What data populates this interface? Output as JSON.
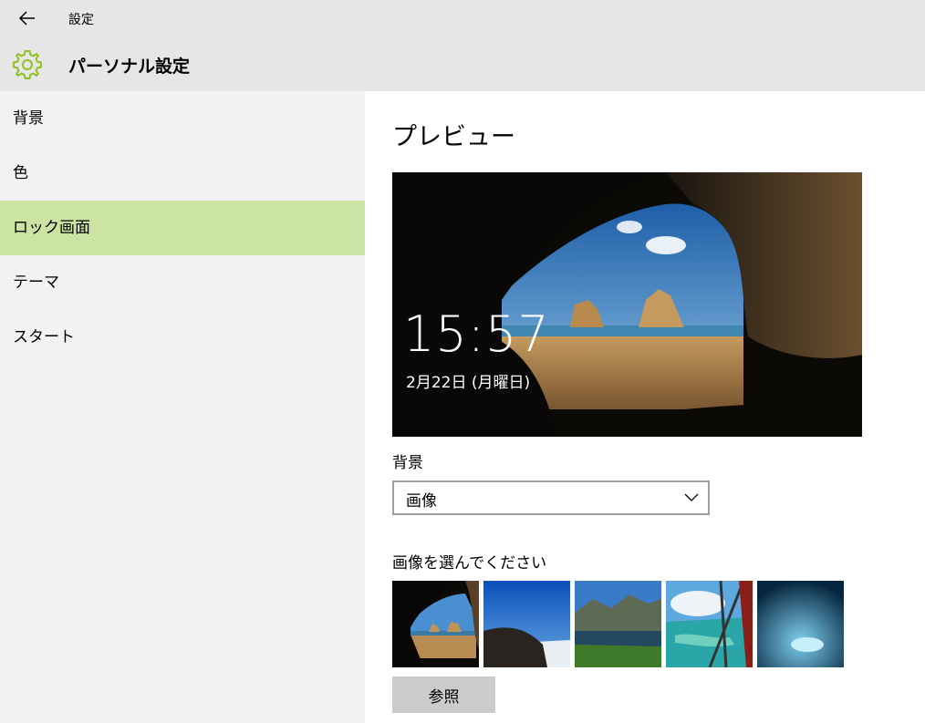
{
  "window": {
    "title": "設定"
  },
  "header": {
    "title": "パーソナル設定"
  },
  "sidebar": {
    "items": [
      {
        "label": "背景"
      },
      {
        "label": "色"
      },
      {
        "label": "ロック画面",
        "selected": true
      },
      {
        "label": "テーマ"
      },
      {
        "label": "スタート"
      }
    ],
    "selected_color": "#cce4a3"
  },
  "main": {
    "preview_title": "プレビュー",
    "preview": {
      "time": "15:57",
      "date": "2月22日 (月曜日)"
    },
    "background_label": "背景",
    "background_dropdown": {
      "value": "画像"
    },
    "choose_label": "画像を選んでください",
    "thumbnails": [
      {
        "name": "cave-beach"
      },
      {
        "name": "hill-sky"
      },
      {
        "name": "mountain-lake"
      },
      {
        "name": "aerial-coast"
      },
      {
        "name": "ice-cave"
      }
    ],
    "browse_label": "参照"
  },
  "colors": {
    "accent_gear": "#8dc21f",
    "topbar": "#e6e6e6",
    "sidebar": "#f2f2f2"
  },
  "icons": {
    "back": "back-arrow-icon",
    "settings": "gear-icon",
    "dropdown": "chevron-down-icon"
  }
}
